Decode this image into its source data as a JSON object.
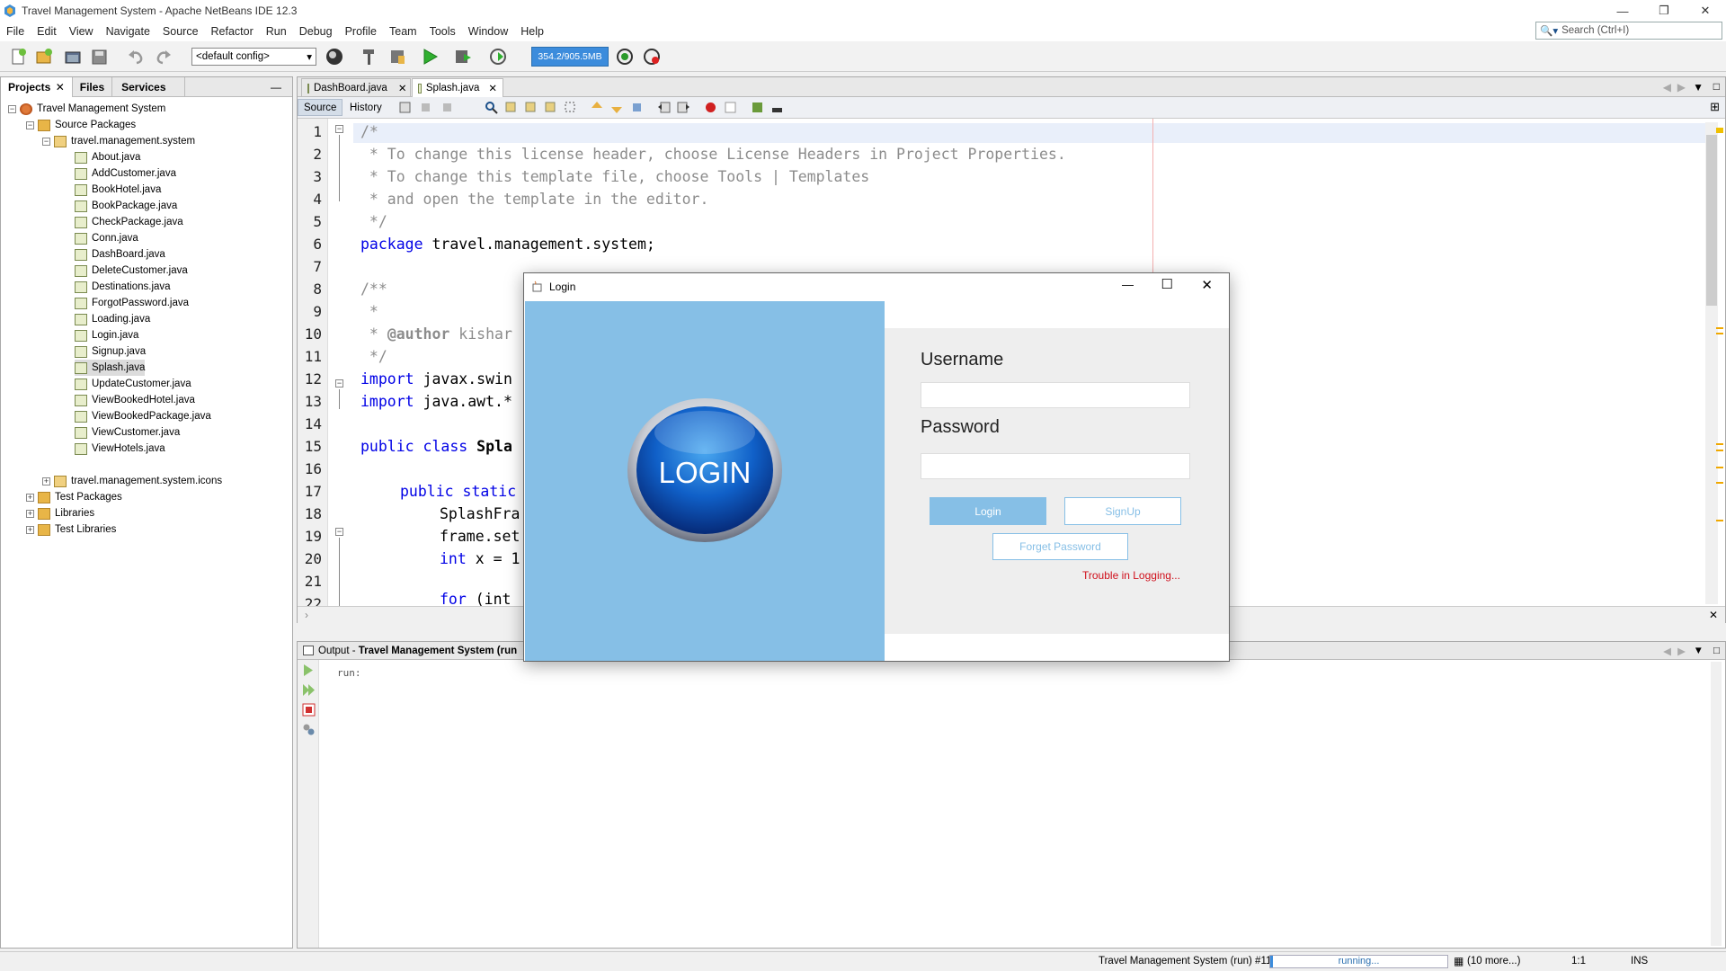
{
  "window": {
    "title": "Travel Management System - Apache NetBeans IDE 12.3"
  },
  "menu": [
    "File",
    "Edit",
    "View",
    "Navigate",
    "Source",
    "Refactor",
    "Run",
    "Debug",
    "Profile",
    "Team",
    "Tools",
    "Window",
    "Help"
  ],
  "search": {
    "placeholder": "Search (Ctrl+I)"
  },
  "toolbar": {
    "config": "<default config>",
    "memory": "354.2/905.5MB"
  },
  "left_panel": {
    "tabs": [
      "Projects",
      "Files",
      "Services"
    ],
    "tree": {
      "project": "Travel Management System",
      "source_packages": "Source Packages",
      "package": "travel.management.system",
      "files": [
        "About.java",
        "AddCustomer.java",
        "BookHotel.java",
        "BookPackage.java",
        "CheckPackage.java",
        "Conn.java",
        "DashBoard.java",
        "DeleteCustomer.java",
        "Destinations.java",
        "ForgotPassword.java",
        "Loading.java",
        "Login.java",
        "Signup.java",
        "Splash.java",
        "UpdateCustomer.java",
        "ViewBookedHotel.java",
        "ViewBookedPackage.java",
        "ViewCustomer.java",
        "ViewHotels.java"
      ],
      "icons_package": "travel.management.system.icons",
      "test_packages": "Test Packages",
      "libraries": "Libraries",
      "test_libraries": "Test Libraries"
    }
  },
  "editor": {
    "tabs": [
      "DashBoard.java",
      "Splash.java"
    ],
    "active_tab": "Splash.java",
    "mode_tabs": [
      "Source",
      "History"
    ],
    "line_numbers": [
      "1",
      "2",
      "3",
      "4",
      "5",
      "6",
      "7",
      "8",
      "9",
      "10",
      "11",
      "12",
      "13",
      "14",
      "15",
      "16",
      "17",
      "18",
      "19",
      "20",
      "21",
      "22"
    ],
    "code": {
      "l1": "/*",
      "l2": " * To change this license header, choose License Headers in Project Properties.",
      "l3": " * To change this template file, choose Tools | Templates",
      "l4": " * and open the template in the editor.",
      "l5": " */",
      "l6_kw": "package",
      "l6_rest": " travel.management.system;",
      "l8": "/**",
      "l9": " *",
      "l10_pre": " * ",
      "l10_tag": "@author",
      "l10_rest": " kishar",
      "l11": " */",
      "l12_kw": "import",
      "l12_rest": " javax.swin",
      "l13_kw": "import",
      "l13_rest": " java.awt.*",
      "l15_kw": "public class",
      "l15_rest": " Spla",
      "l17_kw": "public static",
      "l18": "SplashFra",
      "l19": "frame.set",
      "l20_kw": "int",
      "l20_rest": " x = 1",
      "l22_kw": "for",
      "l22_rest": " (int"
    }
  },
  "output": {
    "title_prefix": "Output - ",
    "title_bold": "Travel Management System (run",
    "text": "run:"
  },
  "statusbar": {
    "task": "Travel Management System (run) #11",
    "progress": "running...",
    "more": "(10 more...)",
    "position": "1:1",
    "mode": "INS"
  },
  "login_dialog": {
    "title": "Login",
    "logo_text": "LOGIN",
    "username_label": "Username",
    "password_label": "Password",
    "login_button": "Login",
    "signup_button": "SignUp",
    "forget_button": "Forget Password",
    "trouble_text": "Trouble in Logging...",
    "colors": {
      "left_panel": "#86bfe6",
      "trouble": "#d0101c",
      "button": "#86bfe6"
    }
  }
}
